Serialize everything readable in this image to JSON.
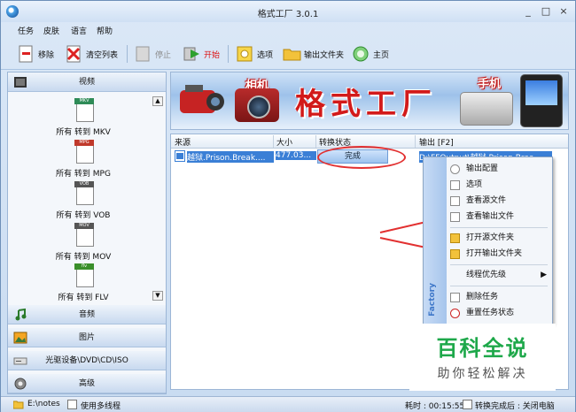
{
  "window": {
    "title": "格式工厂 3.0.1",
    "min": "_",
    "max": "□",
    "close": "×"
  },
  "menu": [
    "任务",
    "皮肤",
    "语言",
    "帮助"
  ],
  "toolbar": {
    "remove": "移除",
    "clear": "清空列表",
    "stop": "停止",
    "start": "开始",
    "options": "选项",
    "output_folder": "输出文件夹",
    "home": "主页"
  },
  "sidebar": {
    "video": "视频",
    "formats": [
      {
        "tag": "MKV",
        "color": "#2e8b57",
        "label": "所有 转到 MKV"
      },
      {
        "tag": "MPG",
        "color": "#c0392b",
        "label": "所有 转到 MPG"
      },
      {
        "tag": "VOB",
        "color": "#555555",
        "label": "所有 转到 VOB"
      },
      {
        "tag": "MOV",
        "color": "#555555",
        "label": "所有 转到 MOV"
      },
      {
        "tag": "flv",
        "color": "#3a8f2a",
        "label": "所有 转到 FLV"
      }
    ],
    "audio": "音频",
    "image": "图片",
    "rom": "光驱设备\\DVD\\CD\\ISO",
    "advanced": "高级",
    "scroll_up": "▲",
    "scroll_down": "▼"
  },
  "banner": {
    "camera": "相机",
    "title": "格式工厂",
    "phone": "手机"
  },
  "list": {
    "headers": [
      "来源",
      "大小",
      "转换状态",
      "输出 [F2]"
    ],
    "rows": [
      {
        "source": "越狱.Prison.Break....",
        "size": "477.03...",
        "status": "完成",
        "output": "D:\\FFOutput\\越狱.Prison.Brea..."
      }
    ]
  },
  "context_menu": {
    "side_text": "Factory",
    "items": [
      "输出配置",
      "选项",
      "查看源文件",
      "查看输出文件",
      "打开源文件夹",
      "打开输出文件夹",
      "线程优先级",
      "删除任务",
      "重置任务状态"
    ],
    "submenu_arrow": "▶"
  },
  "status": {
    "path": "E:\\notes",
    "multithread": "使用多线程",
    "elapsed": "耗时 : 00:15:55",
    "after": "转换完成后 : 关闭电脑"
  },
  "watermark": {
    "line1": "百科全说",
    "line2": "助你轻松解决"
  }
}
